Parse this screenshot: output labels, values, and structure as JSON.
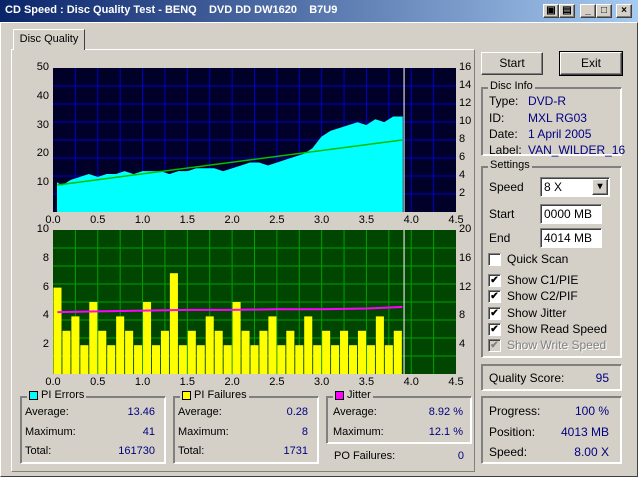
{
  "window": {
    "title": "CD Speed : Disc Quality Test - BENQ    DVD DD DW1620    B7U9",
    "buttons": {
      "minimize": "_",
      "maximize": "□",
      "close": "×"
    }
  },
  "tab": {
    "label": "Disc Quality"
  },
  "chart_data": [
    {
      "type": "area",
      "title": "",
      "x_ticks": [
        "0.0",
        "0.5",
        "1.0",
        "1.5",
        "2.0",
        "2.5",
        "3.0",
        "3.5",
        "4.0",
        "4.5"
      ],
      "y_left_ticks": [
        "50",
        "40",
        "30",
        "20",
        "10"
      ],
      "y_right_ticks": [
        "16",
        "14",
        "12",
        "10",
        "8",
        "6",
        "4",
        "2"
      ],
      "xlim": [
        0,
        4.5
      ],
      "ylim_left": [
        0,
        50
      ],
      "ylim_right": [
        0,
        16
      ],
      "grid": true,
      "colors": {
        "background": "#000028",
        "grid": "#0000cc",
        "pie_fill": "#00ffff",
        "speed_line": "#00c000",
        "marker": "#ffffff"
      },
      "series": [
        {
          "name": "PI Errors",
          "x": [
            0.05,
            0.1,
            0.2,
            0.3,
            0.4,
            0.5,
            0.6,
            0.7,
            0.8,
            0.9,
            1.0,
            1.1,
            1.2,
            1.3,
            1.4,
            1.5,
            1.6,
            1.7,
            1.8,
            1.9,
            2.0,
            2.1,
            2.2,
            2.3,
            2.4,
            2.5,
            2.6,
            2.7,
            2.8,
            2.9,
            3.0,
            3.1,
            3.2,
            3.3,
            3.4,
            3.5,
            3.6,
            3.7,
            3.8,
            3.9
          ],
          "y": [
            10,
            9,
            11,
            12,
            13,
            12,
            13,
            13,
            14,
            13,
            14,
            14,
            14,
            13,
            14,
            14,
            15,
            15,
            15,
            14,
            15,
            16,
            17,
            17,
            16,
            17,
            18,
            19,
            20,
            22,
            26,
            28,
            29,
            30,
            31,
            30,
            32,
            31,
            33,
            33
          ]
        },
        {
          "name": "Read Speed",
          "x": [
            0.05,
            3.9
          ],
          "y": [
            3.0,
            8.0
          ]
        }
      ],
      "end_marker_x": 3.92
    },
    {
      "type": "bar",
      "title": "",
      "x_ticks": [
        "0.0",
        "0.5",
        "1.0",
        "1.5",
        "2.0",
        "2.5",
        "3.0",
        "3.5",
        "4.0",
        "4.5"
      ],
      "y_left_ticks": [
        "10",
        "8",
        "6",
        "4",
        "2"
      ],
      "y_right_ticks": [
        "20",
        "16",
        "12",
        "8",
        "4"
      ],
      "xlim": [
        0,
        4.5
      ],
      "ylim_left": [
        0,
        10
      ],
      "ylim_right": [
        0,
        20
      ],
      "grid": true,
      "colors": {
        "background": "#004600",
        "grid": "#00a000",
        "pif_fill": "#ffff00",
        "jitter": "#ff00ff",
        "marker": "#ffffff"
      },
      "series": [
        {
          "name": "PI Failures",
          "x": [
            0.05,
            0.15,
            0.25,
            0.35,
            0.45,
            0.55,
            0.65,
            0.75,
            0.85,
            0.95,
            1.05,
            1.15,
            1.25,
            1.35,
            1.45,
            1.55,
            1.65,
            1.75,
            1.85,
            1.95,
            2.05,
            2.15,
            2.25,
            2.35,
            2.45,
            2.55,
            2.65,
            2.75,
            2.85,
            2.95,
            3.05,
            3.15,
            3.25,
            3.35,
            3.45,
            3.55,
            3.65,
            3.75,
            3.85
          ],
          "y": [
            6,
            3,
            4,
            2,
            5,
            3,
            2,
            4,
            3,
            2,
            5,
            2,
            3,
            7,
            2,
            3,
            2,
            4,
            3,
            2,
            5,
            3,
            2,
            3,
            4,
            2,
            3,
            2,
            4,
            2,
            3,
            2,
            3,
            2,
            3,
            2,
            4,
            2,
            3
          ]
        },
        {
          "name": "Jitter",
          "x": [
            0.05,
            0.5,
            1.0,
            1.5,
            2.0,
            2.5,
            3.0,
            3.5,
            3.9
          ],
          "y": [
            8.6,
            8.7,
            8.8,
            8.9,
            8.9,
            9.0,
            9.0,
            9.1,
            9.3
          ]
        }
      ],
      "end_marker_x": 3.92
    }
  ],
  "stats": {
    "pi_errors": {
      "title": "PI Errors",
      "color": "#00ffff",
      "average_label": "Average:",
      "average": "13.46",
      "maximum_label": "Maximum:",
      "maximum": "41",
      "total_label": "Total:",
      "total": "161730"
    },
    "pi_failures": {
      "title": "PI Failures",
      "color": "#ffff00",
      "average_label": "Average:",
      "average": "0.28",
      "maximum_label": "Maximum:",
      "maximum": "8",
      "total_label": "Total:",
      "total": "1731"
    },
    "jitter": {
      "title": "Jitter",
      "color": "#ff00ff",
      "average_label": "Average:",
      "average": "8.92 %",
      "maximum_label": "Maximum:",
      "maximum": "12.1 %"
    },
    "po_failures": {
      "label": "PO Failures:",
      "value": "0"
    }
  },
  "buttons": {
    "start": "Start",
    "exit": "Exit"
  },
  "disc_info": {
    "title": "Disc Info",
    "type_label": "Type:",
    "type": "DVD-R",
    "id_label": "ID:",
    "id": "MXL RG03",
    "date_label": "Date:",
    "date": "1 April 2005",
    "label_label": "Label:",
    "label": "VAN_WILDER_16"
  },
  "settings": {
    "title": "Settings",
    "speed_label": "Speed",
    "speed": "8 X",
    "start_label": "Start",
    "start": "0000 MB",
    "end_label": "End",
    "end": "4014 MB",
    "quick_scan": "Quick Scan",
    "show_c1": "Show C1/PIE",
    "show_c2": "Show C2/PIF",
    "show_jitter": "Show Jitter",
    "show_read": "Show Read Speed",
    "show_write": "Show Write Speed",
    "check": "✔"
  },
  "quality": {
    "label": "Quality Score:",
    "value": "95"
  },
  "progress": {
    "progress_label": "Progress:",
    "progress": "100 %",
    "position_label": "Position:",
    "position": "4013 MB",
    "speed_label": "Speed:",
    "speed": "8.00 X"
  }
}
